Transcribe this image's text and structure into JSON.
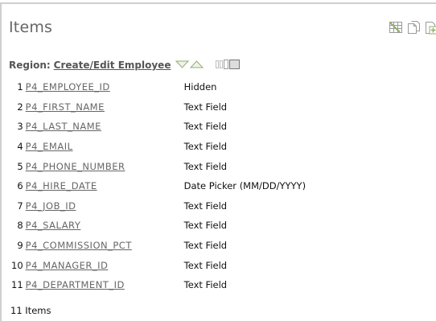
{
  "panel": {
    "title": "Items",
    "header_icons": [
      "grid-edit-icon",
      "copy-page-icon",
      "add-item-icon"
    ]
  },
  "region": {
    "label": "Region:",
    "name": "Create/Edit Employee",
    "sort_icons": [
      "sort-down-icon",
      "sort-up-icon"
    ],
    "layout_icon": "region-layout-icon"
  },
  "items": [
    {
      "seq": "1",
      "name": "P4_EMPLOYEE_ID",
      "type": "Hidden"
    },
    {
      "seq": "2",
      "name": "P4_FIRST_NAME",
      "type": "Text Field"
    },
    {
      "seq": "3",
      "name": "P4_LAST_NAME",
      "type": "Text Field"
    },
    {
      "seq": "4",
      "name": "P4_EMAIL",
      "type": "Text Field"
    },
    {
      "seq": "5",
      "name": "P4_PHONE_NUMBER",
      "type": "Text Field"
    },
    {
      "seq": "6",
      "name": "P4_HIRE_DATE",
      "type": "Date Picker (MM/DD/YYYY)"
    },
    {
      "seq": "7",
      "name": "P4_JOB_ID",
      "type": "Text Field"
    },
    {
      "seq": "8",
      "name": "P4_SALARY",
      "type": "Text Field"
    },
    {
      "seq": "9",
      "name": "P4_COMMISSION_PCT",
      "type": "Text Field"
    },
    {
      "seq": "10",
      "name": "P4_MANAGER_ID",
      "type": "Text Field"
    },
    {
      "seq": "11",
      "name": "P4_DEPARTMENT_ID",
      "type": "Text Field"
    }
  ],
  "footer": {
    "count": "11 Items"
  },
  "colors": {
    "border": "#cfcfcf",
    "title": "#666666",
    "link": "#666666",
    "icon_green": "#8fb06a",
    "icon_gray": "#9a9a9a"
  }
}
